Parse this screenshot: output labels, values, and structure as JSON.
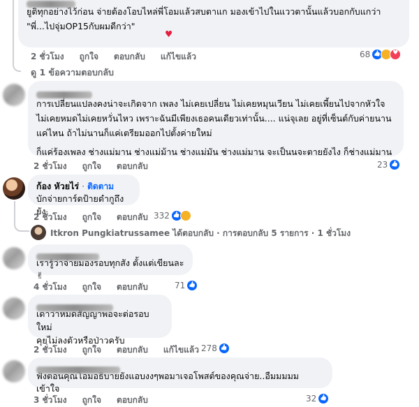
{
  "comments": [
    {
      "text": "ยูติทุกอย่างไว้ก่อน จ่ายต้องโอบไหล่พี่โอมแล้วสบตาแก มองเข้าไปในแววตานั้นแล้วบอกกับแกว่า\n\"พี่...ไปจุ่มOP15กับผมดีกว่า\"",
      "heart": "♥",
      "time": "2 ชั่วโมง",
      "like": "ถูกใจ",
      "reply": "ตอบกลับ",
      "edited": "แก้ไขแล้ว",
      "count": "68",
      "view_replies": "ดู 1 ข้อความตอบกลับ"
    },
    {
      "text": "การเปลี่ยนแปลงคงน่าจะเกิดจาก เพลง ไม่เคยเปลี่ยน ไม่เคยหมุนเวียน ไม่เคยเพี้ยนไปจากหัวใจ\nไม่เคยหมดไม่เคยหวั่นไหว เพราะฉันมีเพียงเธอคนเดียวเท่านั้น.... แน่จุเลย อยู่ที่เซ็นต์กับค่ายนาน\nแค่ไหน ถ้าไม่นานก็แค่เตรียมออกไปตั้งค่ายใหม่",
      "text2": "ก็แค่ร้องเพลง ช่างแม่มาน ช่างแม่ม้าน ช่างแม่มัน ช่างแม่มาน จะเป็นนจะตายยังไง ก็ช่างแม่มาน",
      "time": "2 ชั่วโมง",
      "like": "ถูกใจ",
      "reply": "ตอบกลับ",
      "count": "23"
    },
    {
      "author": "ก้อง หัวยไร่",
      "follow": "ติดตาม",
      "text": "บักจ่ายการ์ดป้ายดำกูถึงยัง",
      "time": "2 ชั่วโมง",
      "like": "ถูกใจ",
      "reply": "ตอบกลับ",
      "count": "332",
      "reply_summary": "Itkron Pungkiatrussamee ได้ตอบกลับ · การตอบกลับ 5 รายการ · 1 ชั่วโมง"
    },
    {
      "text": "เรารู้ว่าจ่ายมองรอบทุกสัง ตั้งแต่เขียนละ ✌",
      "time": "4 ชั่วโมง",
      "like": "ถูกใจ",
      "reply": "ตอบกลับ",
      "count": "71"
    },
    {
      "text": "เดาว่าหมดสัญญาพอจะต่อรอบใหม่\nคุยไม่ลงตัวหรือป่าวครับ",
      "time": "2 ชั่วโมง",
      "like": "ถูกใจ",
      "reply": "ตอบกลับ",
      "edited": "แก้ไขแล้ว",
      "count": "278"
    },
    {
      "text": "ฟังตอนคุณโอมอธิบายยังแอบงงๆพอมาเจอโพสต์ของคุณจ่าย..อืมมมมม เข้าใจ",
      "time": "3 ชั่วโมง",
      "like": "ถูกใจ",
      "reply": "ตอบกลับ",
      "count": "32"
    }
  ]
}
